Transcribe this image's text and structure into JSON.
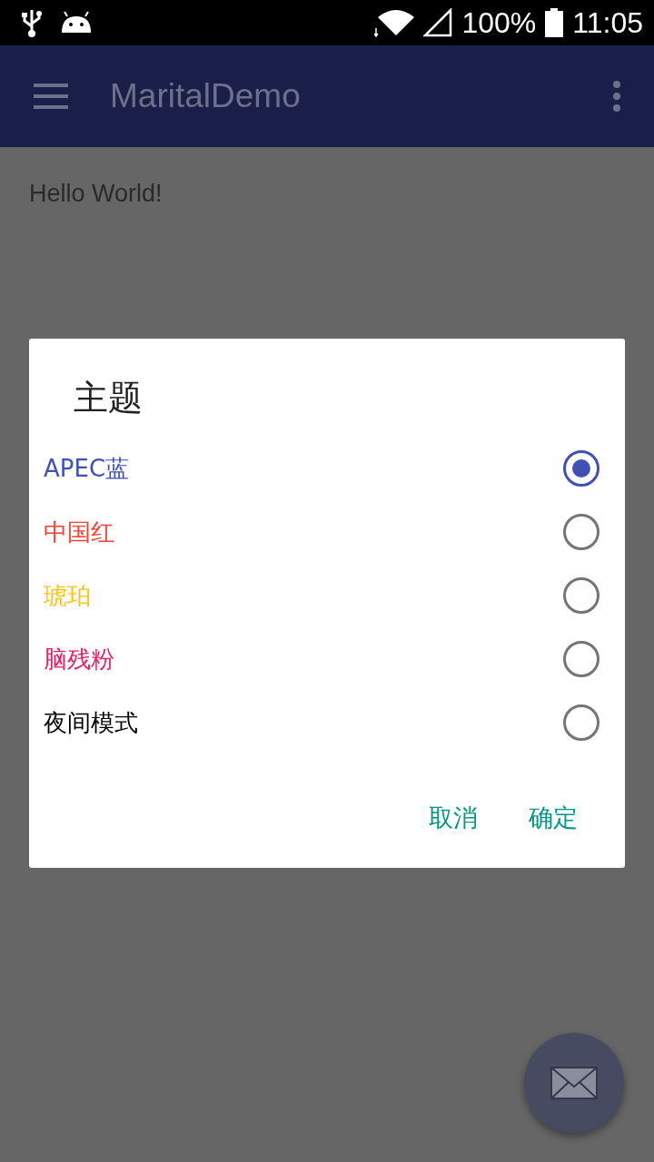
{
  "status_bar": {
    "battery_text": "100%",
    "time": "11:05"
  },
  "app_bar": {
    "title": "MaritalDemo"
  },
  "content": {
    "text": "Hello World!"
  },
  "dialog": {
    "title": "主题",
    "options": [
      {
        "label": "APEC蓝",
        "color": "#3f51b5",
        "selected": true
      },
      {
        "label": "中国红",
        "color": "#f44336",
        "selected": false
      },
      {
        "label": "琥珀",
        "color": "#ffc107",
        "selected": false
      },
      {
        "label": "脑残粉",
        "color": "#e91e63",
        "selected": false
      },
      {
        "label": "夜间模式",
        "color": "#000000",
        "selected": false
      }
    ],
    "buttons": [
      "取消",
      "确定"
    ]
  }
}
